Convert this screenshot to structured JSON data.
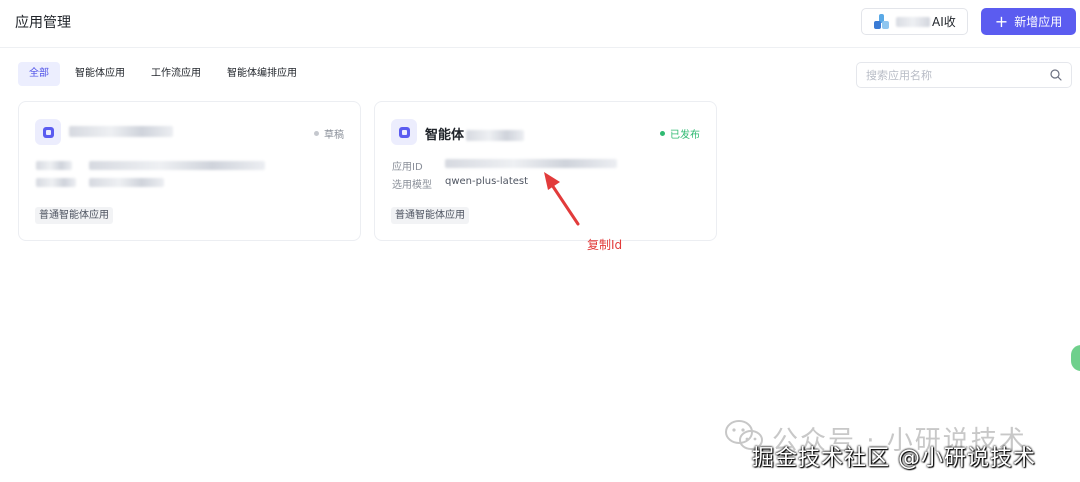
{
  "header": {
    "title": "应用管理",
    "partner_button_suffix": "AI收",
    "new_app_label": "新增应用",
    "plus_glyph": "+"
  },
  "tabs": [
    {
      "label": "全部",
      "active": true
    },
    {
      "label": "智能体应用",
      "active": false
    },
    {
      "label": "工作流应用",
      "active": false
    },
    {
      "label": "智能体编排应用",
      "active": false
    }
  ],
  "search": {
    "placeholder": "搜索应用名称"
  },
  "cards": [
    {
      "status": "草稿",
      "status_color": "#c5c8ce",
      "tag": "普通智能体应用"
    },
    {
      "name_prefix": "智能体",
      "status": "已发布",
      "status_color": "#2fba72",
      "app_id_label": "应用ID",
      "model_label": "选用模型",
      "model_value": "qwen-plus-latest",
      "tag": "普通智能体应用"
    }
  ],
  "annotation": {
    "text": "复制Id",
    "color": "#e23b3b"
  },
  "watermark": {
    "line1": "公众号 · 小研说技术",
    "line2": "掘金技术社区 @小研说技术"
  },
  "colors": {
    "primary": "#5b5cf0",
    "active_tab_bg": "#eceefe"
  }
}
